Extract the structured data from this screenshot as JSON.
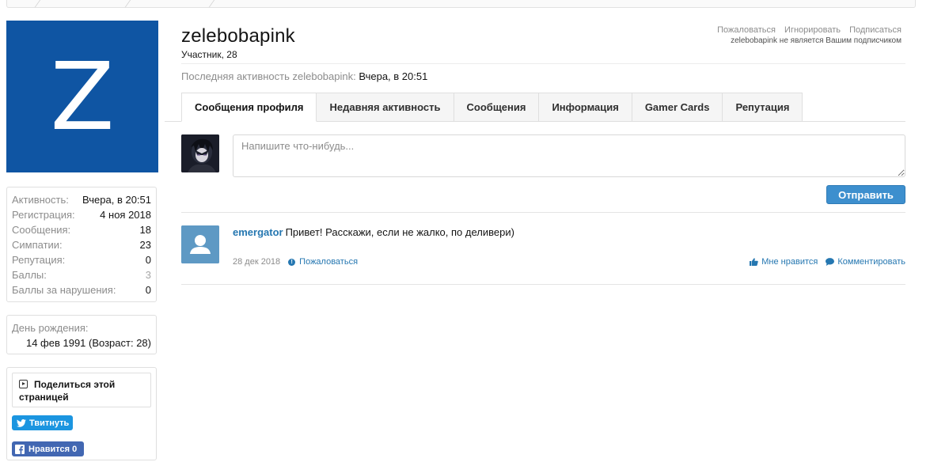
{
  "sidebar": {
    "avatar_letter": "Z",
    "avatar_color": "#0f55a3",
    "stats": [
      {
        "label": "Активность:",
        "value": "Вчера, в 20:51"
      },
      {
        "label": "Регистрация:",
        "value": "4 ноя 2018"
      },
      {
        "label": "Сообщения:",
        "value": "18"
      },
      {
        "label": "Симпатии:",
        "value": "23"
      },
      {
        "label": "Репутация:",
        "value": "0"
      },
      {
        "label": "Баллы:",
        "value": "3"
      },
      {
        "label": "Баллы за нарушения:",
        "value": "0"
      }
    ],
    "birthday": {
      "label": "День рождения:",
      "value": "14 фев 1991 (Возраст: 28)"
    },
    "share": {
      "title": "Поделиться этой страницей",
      "tweet_label": "Твитнуть",
      "like_label": "Нравится 0"
    }
  },
  "header": {
    "username": "zelebobapink",
    "user_title": "Участник, 28",
    "links": [
      "Пожаловаться",
      "Игнорировать",
      "Подписаться"
    ],
    "follow_status": "zelebobapink не является Вашим подписчиком",
    "last_activity_label": "Последняя активность zelebobapink:",
    "last_activity_value": "Вчера, в 20:51"
  },
  "tabs": [
    {
      "label": "Сообщения профиля",
      "active": true
    },
    {
      "label": "Недавняя активность",
      "active": false
    },
    {
      "label": "Сообщения",
      "active": false
    },
    {
      "label": "Информация",
      "active": false
    },
    {
      "label": "Gamer Cards",
      "active": false
    },
    {
      "label": "Репутация",
      "active": false
    }
  ],
  "post_form": {
    "placeholder": "Напишите что-нибудь...",
    "value": "",
    "submit_label": "Отправить"
  },
  "messages": [
    {
      "author": "emergator",
      "text": "Привет! Расскажи, если не жалко, по деливери)",
      "date": "28 дек 2018",
      "report_label": "Пожаловаться",
      "like_label": "Мне нравится",
      "comment_label": "Комментировать"
    }
  ],
  "colors": {
    "accent": "#2577b1",
    "button": "#3d8fce",
    "twitter": "#1b95e0",
    "facebook": "#4267b2"
  }
}
